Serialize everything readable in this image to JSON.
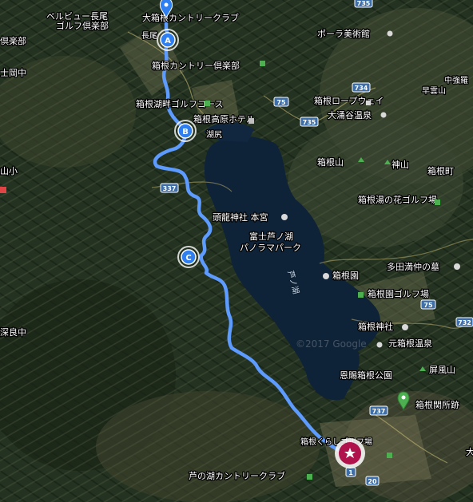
{
  "map": {
    "labels": {
      "bellevue": "ベルビュー長尾",
      "bellevue2": "ゴルフ倶楽部",
      "oohakone": "大箱根カントリークラブ",
      "club_l": "倶楽部",
      "fujioka": "士岡中",
      "hakone_cc": "箱根カントリー倶楽部",
      "kohan_golf": "箱根湖畔ゴルフコース",
      "kogen_hotel": "箱根高原ホテル",
      "kojiri": "湖尻",
      "yamashou": "山小",
      "pola": "ポーラ美術館",
      "hakone_ropeway": "箱根ロープウェイ",
      "owakudani": "大涌谷温泉",
      "nakagora": "中強羅",
      "soun": "早雲山",
      "hakoneyama": "箱根山",
      "kamiyama": "神山",
      "hakone_machi": "箱根町",
      "hananomachi": "箱根湯の花ゴルフ場",
      "kuzuryu": "頭龍神社 本宮",
      "ashinoko_panorama1": "富士芦ノ湖",
      "ashinoko_panorama2": "パノラマパーク",
      "ashinoko_lake": "芦ノ湖",
      "hakone_en": "箱根園",
      "tada": "多田満仲の墓",
      "hakone_en_golf": "箱根園ゴルフ場",
      "hakone_jinja": "箱根神社",
      "moto_hakone": "元箱根温泉",
      "onshi": "恩賜箱根公園",
      "byobuyama": "屏風山",
      "sekisho": "箱根関所跡",
      "fukara": "深良中",
      "ashinoko_cc": "芦の湖カントリークラブ",
      "hakone_golf": "箱根くらしゴルフ場",
      "chou": "長尾",
      "dai": "大"
    },
    "shields": [
      "735",
      "734",
      "75",
      "735",
      "337",
      "75",
      "732",
      "737",
      "1",
      "20",
      "732"
    ],
    "waypoints": [
      "A",
      "B",
      "C"
    ],
    "watermark": "©2017 Google"
  }
}
